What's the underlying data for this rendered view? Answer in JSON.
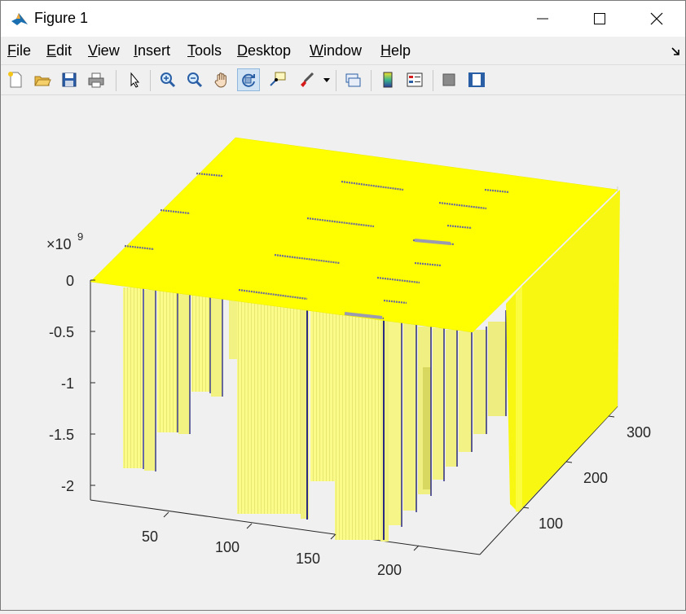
{
  "window": {
    "title": "Figure 1"
  },
  "menu": {
    "file": "File",
    "edit": "Edit",
    "view": "View",
    "insert": "Insert",
    "tools": "Tools",
    "desktop": "Desktop",
    "window": "Window",
    "help": "Help"
  },
  "toolbar": {
    "icons": [
      "new-figure-icon",
      "open-file-icon",
      "save-icon",
      "print-icon",
      "edit-plot-arrow-icon",
      "zoom-in-icon",
      "zoom-out-icon",
      "pan-hand-icon",
      "rotate-3d-icon",
      "data-cursor-icon",
      "brush-icon",
      "brush-dropdown-icon",
      "link-plot-icon",
      "insert-colorbar-icon",
      "insert-legend-icon",
      "hide-plot-tools-icon",
      "show-plot-tools-icon"
    ],
    "active": "rotate-3d-icon"
  },
  "chart_data": {
    "type": "surface",
    "exponent_base": "×10",
    "exponent_power": "9",
    "z_ticks": [
      "0",
      "-0.5",
      "-1",
      "-1.5",
      "-2"
    ],
    "x_ticks": [
      "50",
      "100",
      "150",
      "200"
    ],
    "y_ticks": [
      "100",
      "200",
      "300"
    ],
    "zlim": [
      -2.1,
      0
    ],
    "surface_color": "#ffff00",
    "grid": false
  }
}
